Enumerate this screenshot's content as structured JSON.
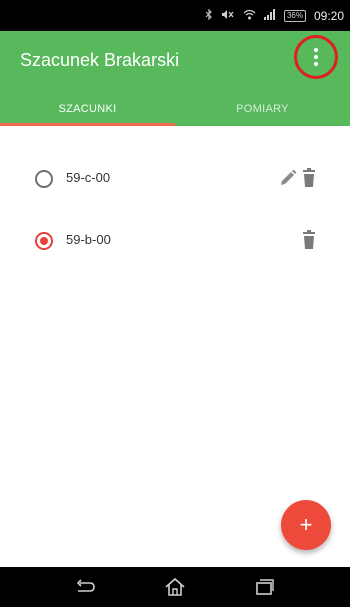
{
  "status_bar": {
    "battery": "36%",
    "time": "09:20",
    "icons": [
      "bluetooth-icon",
      "mute-icon",
      "wifi-icon",
      "signal-icon",
      "battery-icon"
    ]
  },
  "app_bar": {
    "title": "Szacunek Brakarski",
    "menu_icon": "more-vertical-icon",
    "color": "#57b85c"
  },
  "tabs": [
    {
      "label": "SZACUNKI",
      "active": true
    },
    {
      "label": "POMIARY",
      "active": false
    }
  ],
  "list": {
    "items": [
      {
        "label": "59-c-00",
        "selected": false,
        "actions": [
          "edit-icon",
          "delete-icon"
        ]
      },
      {
        "label": "59-b-00",
        "selected": true,
        "actions": [
          "delete-icon"
        ]
      }
    ]
  },
  "fab": {
    "label": "+",
    "color": "#ee4a3c"
  },
  "nav_bar": {
    "buttons": [
      "back-icon",
      "home-icon",
      "recents-icon"
    ]
  }
}
